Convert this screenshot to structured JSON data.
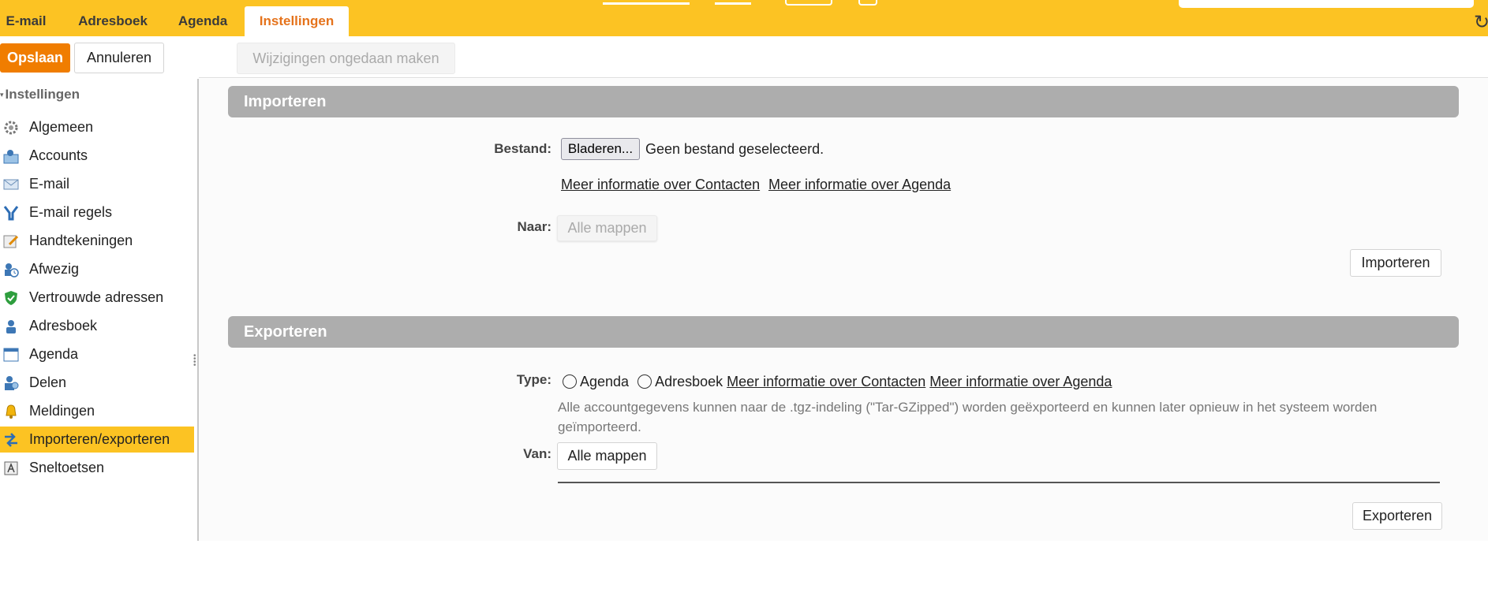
{
  "tabs": [
    {
      "label": "E-mail"
    },
    {
      "label": "Adresboek"
    },
    {
      "label": "Agenda"
    },
    {
      "label": "Instellingen"
    }
  ],
  "toolbar": {
    "save_label": "Opslaan",
    "cancel_label": "Annuleren",
    "undo_label": "Wijzigingen ongedaan maken"
  },
  "sidebar": {
    "header": "Instellingen",
    "items": [
      {
        "label": "Algemeen",
        "icon": "gear-icon"
      },
      {
        "label": "Accounts",
        "icon": "account-icon"
      },
      {
        "label": "E-mail",
        "icon": "envelope-icon"
      },
      {
        "label": "E-mail regels",
        "icon": "filter-icon"
      },
      {
        "label": "Handtekeningen",
        "icon": "signature-icon"
      },
      {
        "label": "Afwezig",
        "icon": "away-clock-icon"
      },
      {
        "label": "Vertrouwde adressen",
        "icon": "shield-check-icon"
      },
      {
        "label": "Adresboek",
        "icon": "person-icon"
      },
      {
        "label": "Agenda",
        "icon": "calendar-icon"
      },
      {
        "label": "Delen",
        "icon": "share-people-icon"
      },
      {
        "label": "Meldingen",
        "icon": "bell-icon"
      },
      {
        "label": "Importeren/exporteren",
        "icon": "import-export-icon",
        "selected": true
      },
      {
        "label": "Sneltoetsen",
        "icon": "keyboard-icon"
      }
    ]
  },
  "import": {
    "title": "Importeren",
    "file_label": "Bestand:",
    "browse_label": "Bladeren...",
    "no_file_text": "Geen bestand geselecteerd.",
    "link_contacts": "Meer informatie over Contacten",
    "link_calendar": "Meer informatie over Agenda",
    "to_label": "Naar:",
    "folder_button": "Alle mappen",
    "import_button": "Importeren"
  },
  "export": {
    "title": "Exporteren",
    "type_label": "Type:",
    "option_calendar": "Agenda",
    "option_addressbook": "Adresboek",
    "link_contacts": "Meer informatie over Contacten",
    "link_calendar": "Meer informatie over Agenda",
    "info_text": "Alle accountgegevens kunnen naar de .tgz-indeling (\"Tar-GZipped\") worden geëxporteerd en kunnen later opnieuw in het systeem worden geïmporteerd.",
    "from_label": "Van:",
    "folder_button": "Alle mappen",
    "export_button": "Exporteren"
  },
  "colors": {
    "accent": "#fcc323",
    "primary_button": "#f07d00",
    "active_tab_text": "#e5731c",
    "section_header": "#adadad"
  }
}
